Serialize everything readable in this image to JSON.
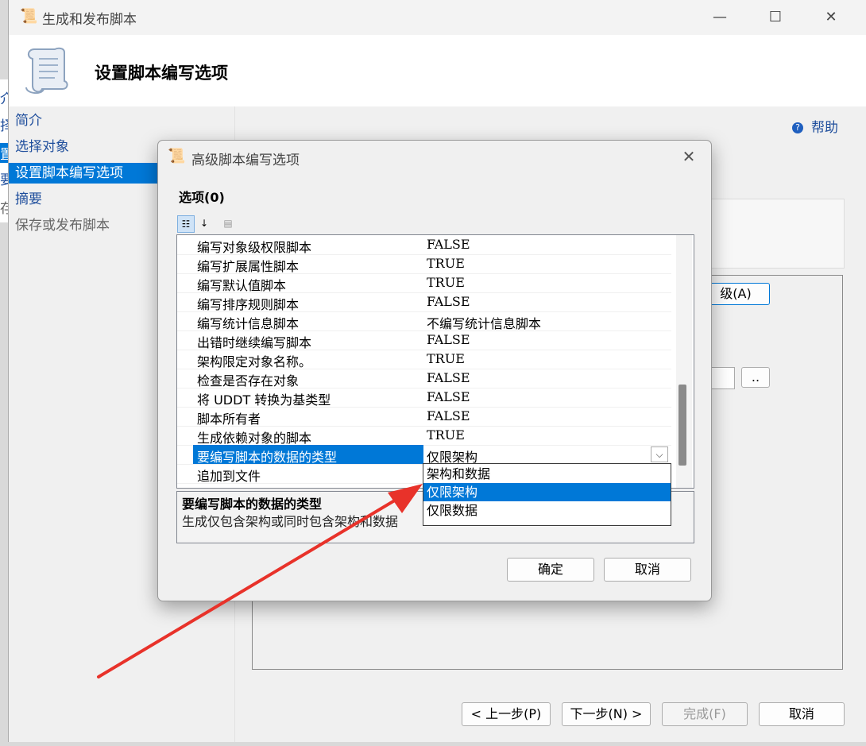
{
  "window": {
    "title": "生成和发布脚本",
    "header_title": "设置脚本编写选项"
  },
  "nav": {
    "items": [
      {
        "label": "简介"
      },
      {
        "label": "选择对象"
      },
      {
        "label": "设置脚本编写选项"
      },
      {
        "label": "摘要"
      },
      {
        "label": "保存或发布脚本"
      }
    ]
  },
  "edge_fragments": [
    "介",
    "择",
    "置",
    "要",
    "存"
  ],
  "content": {
    "help_label": "帮助",
    "advanced_button_fragment": "级(A)",
    "browse_button": ".."
  },
  "wizard_buttons": {
    "prev": "< 上一步(P)",
    "next": "下一步(N) >",
    "finish": "完成(F)",
    "cancel": "取消"
  },
  "dialog": {
    "title": "高级脚本编写选项",
    "section_label": "选项(0)",
    "rows": [
      {
        "name": "编写对象级权限脚本",
        "value": "FALSE"
      },
      {
        "name": "编写扩展属性脚本",
        "value": "TRUE"
      },
      {
        "name": "编写默认值脚本",
        "value": "TRUE"
      },
      {
        "name": "编写排序规则脚本",
        "value": "FALSE"
      },
      {
        "name": "编写统计信息脚本",
        "value": "不编写统计信息脚本"
      },
      {
        "name": "出错时继续编写脚本",
        "value": "FALSE"
      },
      {
        "name": "架构限定对象名称。",
        "value": "TRUE"
      },
      {
        "name": "检查是否存在对象",
        "value": "FALSE"
      },
      {
        "name": "将 UDDT 转换为基类型",
        "value": "FALSE"
      },
      {
        "name": "脚本所有者",
        "value": "FALSE"
      },
      {
        "name": "生成依赖对象的脚本",
        "value": "TRUE"
      },
      {
        "name": "要编写脚本的数据的类型",
        "value": "仅限架构"
      },
      {
        "name": "追加到文件",
        "value": ""
      }
    ],
    "dropdown_options": [
      "架构和数据",
      "仅限架构",
      "仅限数据"
    ],
    "description_title": "要编写脚本的数据的类型",
    "description_text": "生成仅包含架构或同时包含架构和数据",
    "ok_button": "确定",
    "cancel_button": "取消"
  },
  "colors": {
    "selection": "#0078d7",
    "annotation_arrow": "#e8322a",
    "link_blue": "#1f4e9c"
  }
}
